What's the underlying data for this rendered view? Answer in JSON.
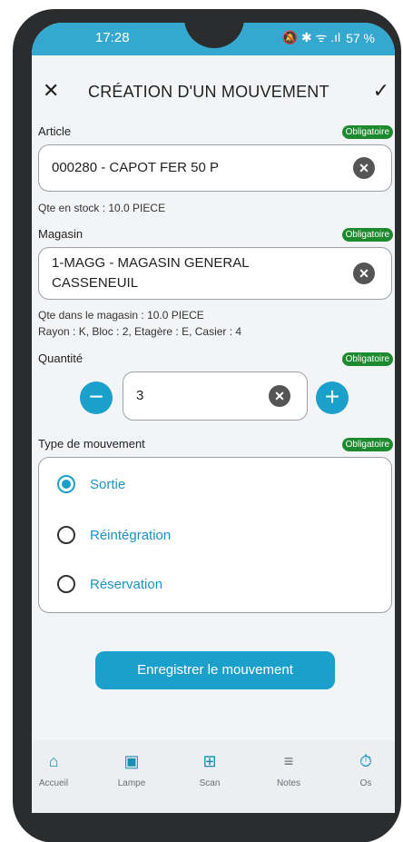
{
  "status_bar": {
    "time": "17:28",
    "icons": "🔕 ✱ ᯤ .ıl",
    "battery": "57 %"
  },
  "header": {
    "title": "CRÉATION D'UN MOUVEMENT"
  },
  "badge_text": "Obligatoire",
  "article": {
    "label": "Article",
    "value": "000280 - CAPOT FER 50 P",
    "stock_info": "Qte en stock : 10.0 PIECE"
  },
  "magasin": {
    "label": "Magasin",
    "value_line1": "1-MAGG - MAGASIN GENERAL",
    "value_line2": "CASSENEUIL",
    "stock_info": "Qte dans le magasin : 10.0 PIECE",
    "location_info": "Rayon : K, Bloc : 2, Etagère : E, Casier : 4"
  },
  "quantite": {
    "label": "Quantité",
    "value": "3"
  },
  "type_mouvement": {
    "label": "Type de mouvement",
    "options": [
      {
        "label": "Sortie",
        "checked": true
      },
      {
        "label": "Réintégration",
        "checked": false
      },
      {
        "label": "Réservation",
        "checked": false
      }
    ]
  },
  "submit_label": "Enregistrer le mouvement",
  "nav": [
    {
      "label": "Accueil",
      "icon": "home-icon"
    },
    {
      "label": "Lampe",
      "icon": "flashlight-icon"
    },
    {
      "label": "Scan",
      "icon": "qr-scan-icon"
    },
    {
      "label": "Notes",
      "icon": "notes-icon"
    },
    {
      "label": "Os",
      "icon": "stopwatch-icon"
    }
  ],
  "colors": {
    "accent": "#1ba0cc",
    "status_bar": "#35a8cf",
    "badge": "#1e8a2f"
  }
}
